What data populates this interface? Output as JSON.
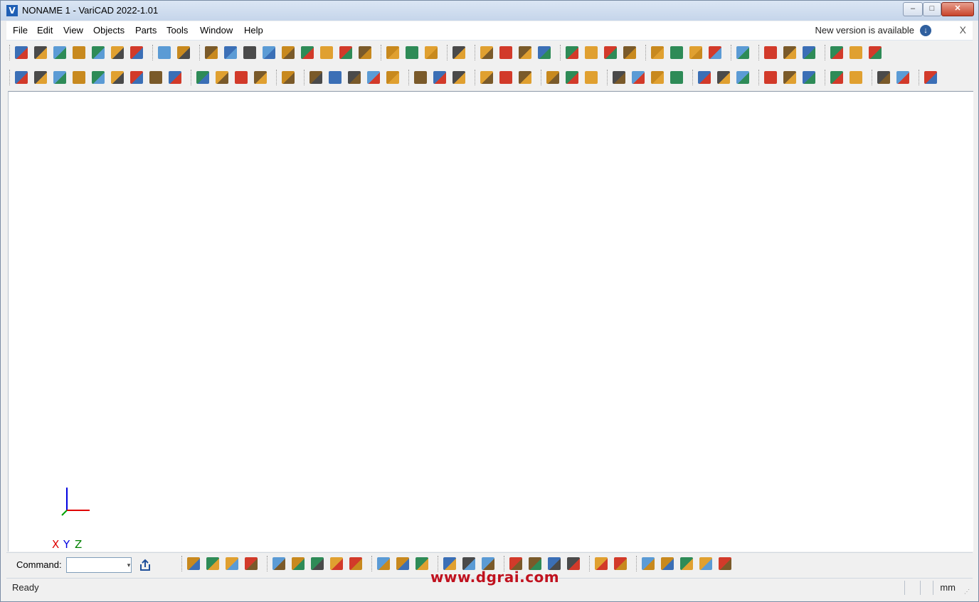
{
  "window": {
    "title": "NONAME 1 - VariCAD 2022-1.01",
    "app_icon_letter": "V",
    "minimize": "–",
    "maximize": "□",
    "close": "✕"
  },
  "menu": {
    "items": [
      "File",
      "Edit",
      "View",
      "Objects",
      "Parts",
      "Tools",
      "Window",
      "Help"
    ],
    "update_notice": "New version is available",
    "update_icon": "download-arrow-icon",
    "dismiss": "X"
  },
  "command": {
    "label": "Command:",
    "value": "",
    "dropdown_glyph": "▾"
  },
  "status": {
    "text": "Ready",
    "unit": "mm"
  },
  "axes": {
    "x_label": "X",
    "y_label": "Y",
    "z_label": "Z",
    "x_color": "#e00000",
    "y_color": "#0000e0",
    "z_color": "#008000"
  },
  "watermark": "www.dgrai.com",
  "colors": {
    "canvas": "#ffffff",
    "chrome": "#f0f0f0",
    "accent": "#1f5fb5"
  }
}
